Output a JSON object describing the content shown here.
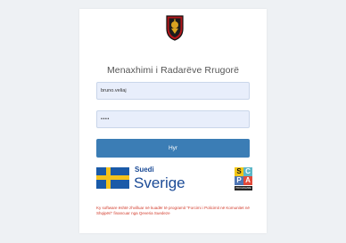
{
  "login": {
    "title": "Menaxhimi i Radarëve Rrugorë",
    "username_value": "bruno.veliaj",
    "password_value": "••••",
    "submit_label": "Hyr"
  },
  "partners": {
    "sweden_small": "Suedi",
    "sweden_large": "Sverige",
    "scpa_letters": [
      "S",
      "C",
      "P",
      "A"
    ],
    "scpa_caption": "PROGRAMME"
  },
  "note": "Ky software është zhvilluar në kuadër të programit \"Forcimi i Policimit në Komunitet në Shqipëri\" financuar nga Qeveria Suedeze",
  "colors": {
    "button": "#3b7db5",
    "field_bg": "#e8eefb",
    "note_text": "#d23b2b",
    "sweden_blue": "#1a5aa8",
    "sweden_yellow": "#f4c21b"
  }
}
